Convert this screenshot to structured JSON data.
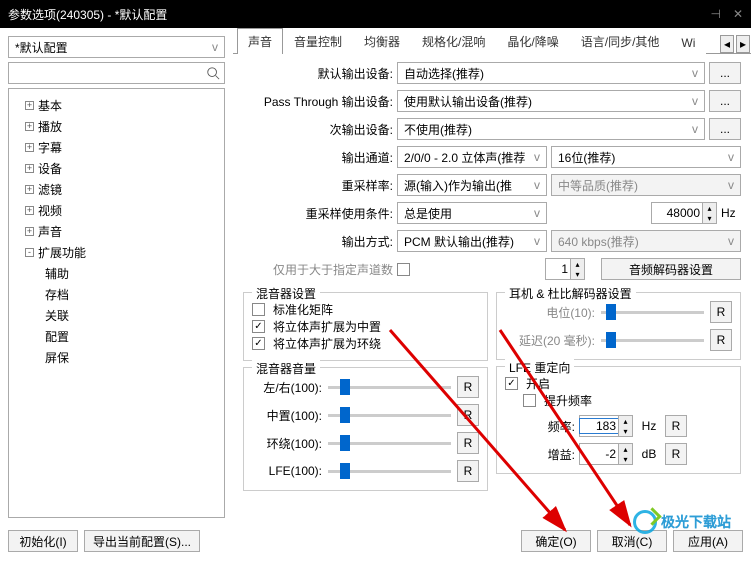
{
  "title": "参数选项(240305) - *默认配置",
  "profile": "*默认配置",
  "tree": [
    "基本",
    "播放",
    "字幕",
    "设备",
    "滤镜",
    "视频",
    "声音",
    "扩展功能"
  ],
  "subtree": [
    "辅助",
    "存档",
    "关联",
    "配置",
    "屏保"
  ],
  "tabs": [
    "声音",
    "音量控制",
    "均衡器",
    "规格化/混响",
    "晶化/降噪",
    "语言/同步/其他",
    "Wi"
  ],
  "labels": {
    "default_out": "默认输出设备:",
    "pass_through": "Pass Through 输出设备:",
    "secondary": "次输出设备:",
    "channel": "输出通道:",
    "resample": "重采样率:",
    "resample_cond": "重采样使用条件:",
    "output_method": "输出方式:",
    "only_above": "仅用于大于指定声道数",
    "decoder_btn": "音频解码器设置",
    "mixer_settings": "混音器设置",
    "normalize": "标准化矩阵",
    "expand_center": "将立体声扩展为中置",
    "expand_surround": "将立体声扩展为环绕",
    "mixer_volume": "混音器音量",
    "left_right": "左/右(100):",
    "center": "中置(100):",
    "surround": "环绕(100):",
    "lfe": "LFE(100):",
    "headphone": "耳机 & 杜比解码器设置",
    "potential": "电位(10):",
    "delay": "延迟(20 毫秒):",
    "lfe_redirect": "LFE 重定向",
    "enable": "开启",
    "boost_freq": "提升频率",
    "freq": "频率:",
    "gain": "增益:",
    "hz": "Hz",
    "db": "dB"
  },
  "values": {
    "default_out": "自动选择(推荐)",
    "pass_through": "使用默认输出设备(推荐)",
    "secondary": "不使用(推荐)",
    "channel": "2/0/0 - 2.0 立体声(推荐",
    "channel_bit": "16位(推荐)",
    "resample": "源(输入)作为输出(推",
    "resample_q": "中等品质(推荐)",
    "resample_cond": "总是使用",
    "resample_val": "48000",
    "output_method": "PCM 默认输出(推荐)",
    "bitrate": "640 kbps(推荐)",
    "channels_spin": "1",
    "freq": "183",
    "gain": "-2"
  },
  "buttons": {
    "init": "初始化(I)",
    "export": "导出当前配置(S)...",
    "ok": "确定(O)",
    "cancel": "取消(C)",
    "apply": "应用(A)"
  },
  "r": "R"
}
